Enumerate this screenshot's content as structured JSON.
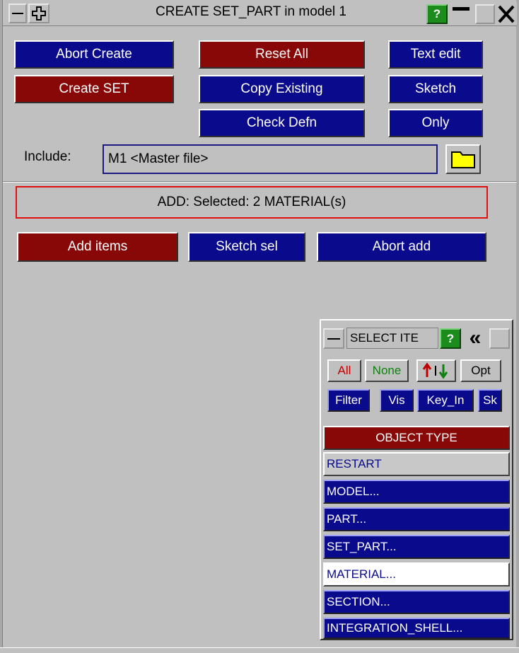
{
  "window": {
    "title": "CREATE SET_PART in model 1",
    "help_label": "?"
  },
  "buttons": {
    "abort_create": "Abort Create",
    "reset_all": "Reset All",
    "text_edit": "Text edit",
    "create_set": "Create SET",
    "copy_existing": "Copy Existing",
    "sketch": "Sketch",
    "check_defn": "Check Defn",
    "only": "Only"
  },
  "include": {
    "label": "Include:",
    "value": "M1  <Master file>"
  },
  "status": "ADD: Selected: 2 MATERIAL(s)",
  "add_buttons": {
    "add_items": "Add items",
    "sketch_sel": "Sketch sel",
    "abort_add": "Abort add"
  },
  "select_panel": {
    "title": "SELECT ITE",
    "help_label": "?",
    "collapse_label": "«",
    "all": "All",
    "none": "None",
    "opt": "Opt",
    "filter": "Filter",
    "vis": "Vis",
    "key_in": "Key_In",
    "sk": "Sk",
    "object_type_header": "OBJECT TYPE",
    "items": [
      {
        "label": "RESTART",
        "state": "plain"
      },
      {
        "label": "MODEL...",
        "state": "normal"
      },
      {
        "label": "PART...",
        "state": "normal"
      },
      {
        "label": "SET_PART...",
        "state": "normal"
      },
      {
        "label": "MATERIAL...",
        "state": "selected"
      },
      {
        "label": "SECTION...",
        "state": "normal"
      },
      {
        "label": "INTEGRATION_SHELL...",
        "state": "normal"
      }
    ]
  },
  "colors": {
    "background": "#c0c0c0",
    "button_blue": "#0a0a8c",
    "button_red": "#880808",
    "help_green": "#1c8c1c",
    "status_border": "#e01010",
    "folder_yellow": "#ffff00"
  }
}
